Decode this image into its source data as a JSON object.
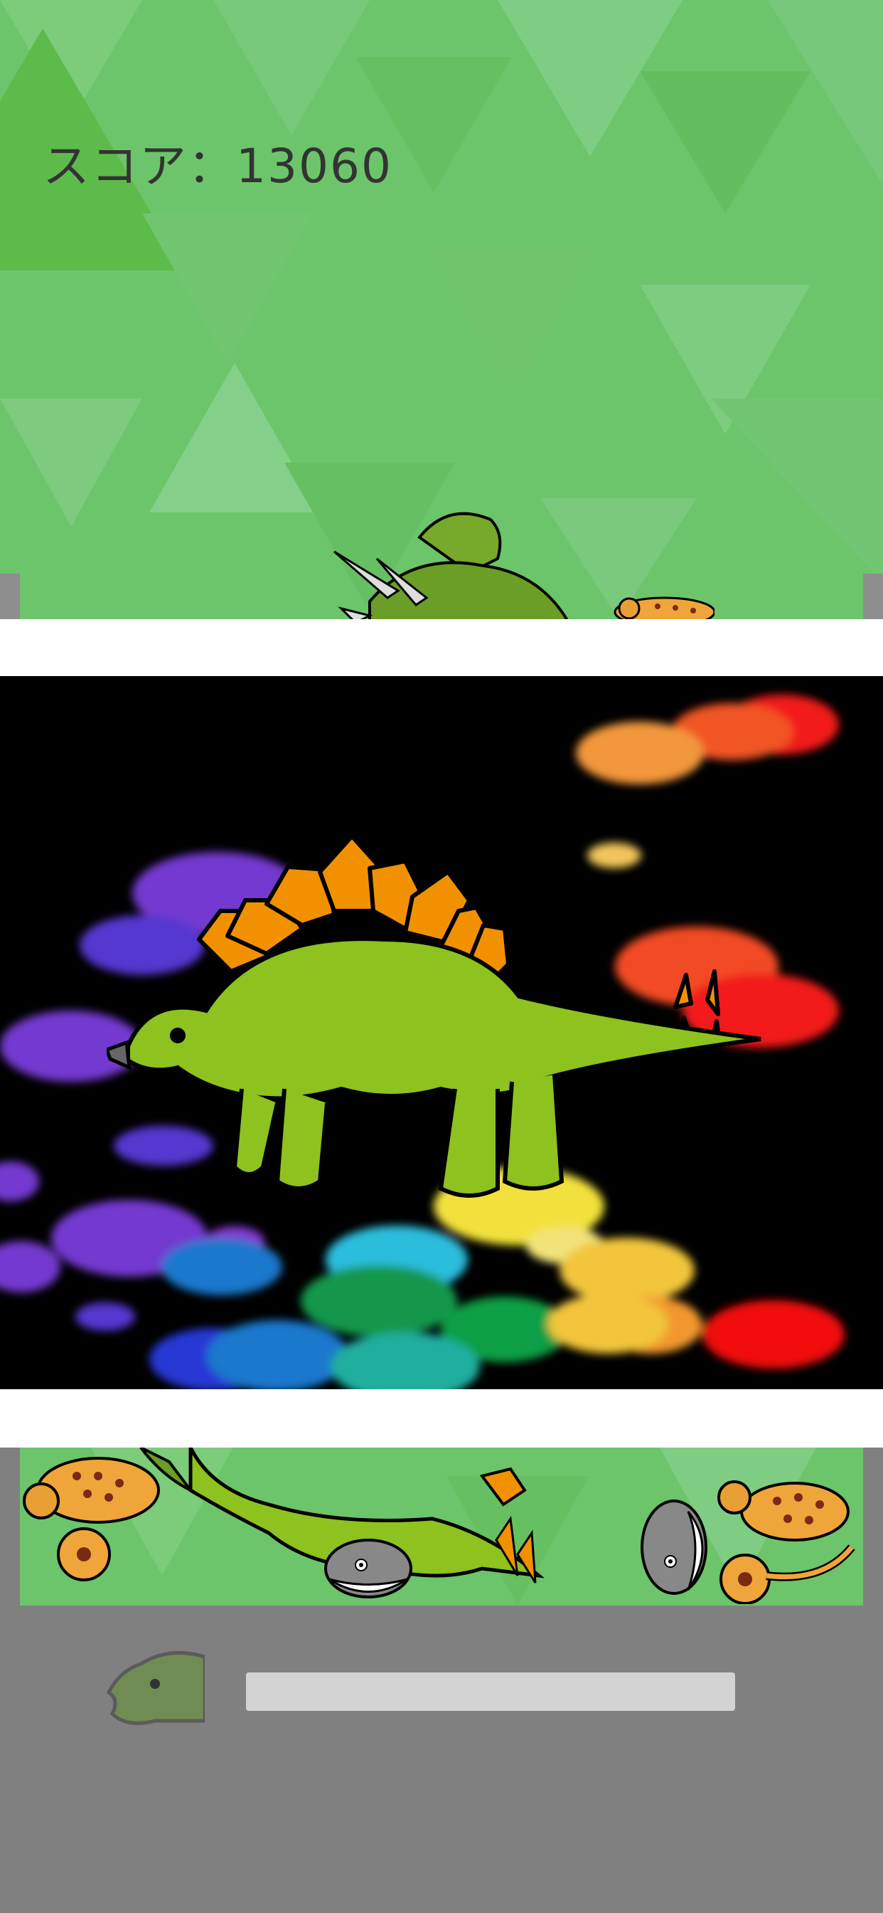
{
  "hud": {
    "score_label": "スコア：13060",
    "score_value": 13060
  },
  "progress": {
    "fraction": 0.0
  },
  "icons": {
    "top_scene": [
      "triceratops-icon",
      "ankylosaurus-icon"
    ],
    "center": "stegosaurus-icon",
    "bottom_scene": [
      "ankylosaurus-icon",
      "stegosaurus-icon",
      "pufferfish-icon",
      "pufferfish-icon",
      "ankylosaurus-icon"
    ],
    "progress_icon": "dinosaur-head-icon"
  },
  "colors": {
    "background_green": "#6cc56a",
    "panel_black": "#000000",
    "stegosaurus_body": "#8dc21f",
    "stegosaurus_plates": "#f29100",
    "gray_area": "#808080",
    "progress_track": "#d3d3d3"
  }
}
